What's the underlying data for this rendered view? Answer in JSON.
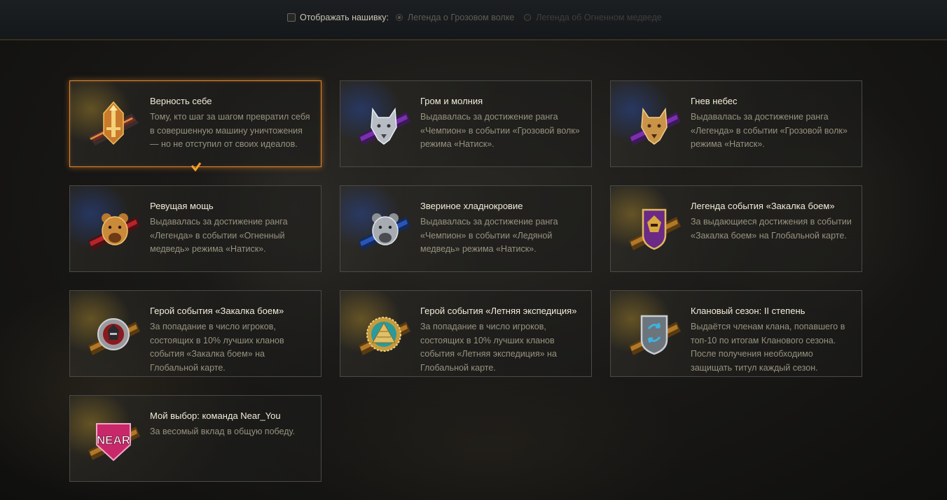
{
  "topbar": {
    "checkbox_label": "Отображать нашивку:",
    "checkbox_checked": false,
    "radio_options": [
      {
        "label": "Легенда о Грозовом волке",
        "selected": true
      },
      {
        "label": "Легенда об Огненном медведе",
        "selected": false
      }
    ]
  },
  "cards": [
    {
      "title": "Верность себе",
      "description": "Тому, кто шаг за шагом превратил себя в совершенную машину уничтожения — но не отступил от своих идеалов.",
      "badge": "gold-insignia-badge",
      "active": true
    },
    {
      "title": "Гром и молния",
      "description": "Выдавалась за достижение ранга «Чемпион» в событии «Грозовой волк» режима «Натиск».",
      "badge": "silver-wolf-badge",
      "active": false
    },
    {
      "title": "Гнев небес",
      "description": "Выдавалась за достижение ранга «Легенда» в событии «Грозовой волк» режима «Натиск».",
      "badge": "gold-wolf-badge",
      "active": false
    },
    {
      "title": "Ревущая мощь",
      "description": "Выдавалась за достижение ранга «Легенда» в событии «Огненный медведь» режима «Натиск».",
      "badge": "gold-bear-badge",
      "active": false
    },
    {
      "title": "Звериное хладнокровие",
      "description": "Выдавалась за достижение ранга «Чемпион» в событии «Ледяной медведь» режима «Натиск».",
      "badge": "silver-bear-badge",
      "active": false
    },
    {
      "title": "Легенда события «Закалка боем»",
      "description": "За выдающиеся достижения в событии «Закалка боем» на Глобальной карте.",
      "badge": "samurai-shield-badge",
      "active": false
    },
    {
      "title": "Герой события «Закалка боем»",
      "description": "За попадание в число игроков, состоящих в 10% лучших кланов события «Закалка боем» на Глобальной карте.",
      "badge": "samurai-round-badge",
      "active": false
    },
    {
      "title": "Герой события «Летняя экспедиция»",
      "description": "За попадание в число игроков, состоящих в 10% лучших кланов события «Летняя экспедиция» на Глобальной карте.",
      "badge": "pyramid-badge",
      "active": false
    },
    {
      "title": "Клановый сезон: II степень",
      "description": "Выдаётся членам клана, попавшего в топ-10 по итогам Кланового сезона. После получения необходимо защищать титул каждый сезон.",
      "badge": "clan-season-badge",
      "active": false
    },
    {
      "title": "Мой выбор: команда Near_You",
      "description": "За весомый вклад в общую победу.",
      "badge": "near-team-badge",
      "badge_text": "NEAR",
      "active": false
    }
  ],
  "colors": {
    "active_border": "#e0892f",
    "title": "#f2ecd9",
    "description": "#97927f"
  }
}
